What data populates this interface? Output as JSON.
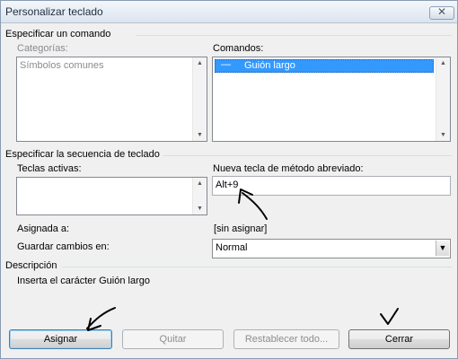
{
  "window": {
    "title": "Personalizar teclado",
    "close_glyph": "✕"
  },
  "command_section": {
    "heading": "Especificar un comando",
    "categories_label": "Categorías:",
    "categories_items": [
      "Símbolos comunes"
    ],
    "commands_label": "Comandos:",
    "commands_items": [
      {
        "glyph": "—",
        "label": "Guión largo",
        "selected": true
      }
    ]
  },
  "key_section": {
    "heading": "Especificar la secuencia de teclado",
    "current_keys_label": "Teclas activas:",
    "new_key_label": "Nueva tecla de método abreviado:",
    "new_key_value": "Alt+9",
    "assigned_to_label": "Asignada a:",
    "assigned_to_value": "[sin asignar]",
    "save_in_label": "Guardar cambios en:",
    "save_in_value": "Normal"
  },
  "description": {
    "heading": "Descripción",
    "text": "Inserta el carácter Guión largo"
  },
  "buttons": {
    "assign": "Asignar",
    "remove": "Quitar",
    "reset_all": "Restablecer todo...",
    "close": "Cerrar"
  },
  "colors": {
    "selection": "#3399ff",
    "dialog_bg": "#f0f0f0",
    "annotation_ink": "#000000"
  },
  "icons": [
    "close-icon",
    "scroll-up-arrow-icon",
    "scroll-down-arrow-icon",
    "dropdown-arrow-icon"
  ]
}
